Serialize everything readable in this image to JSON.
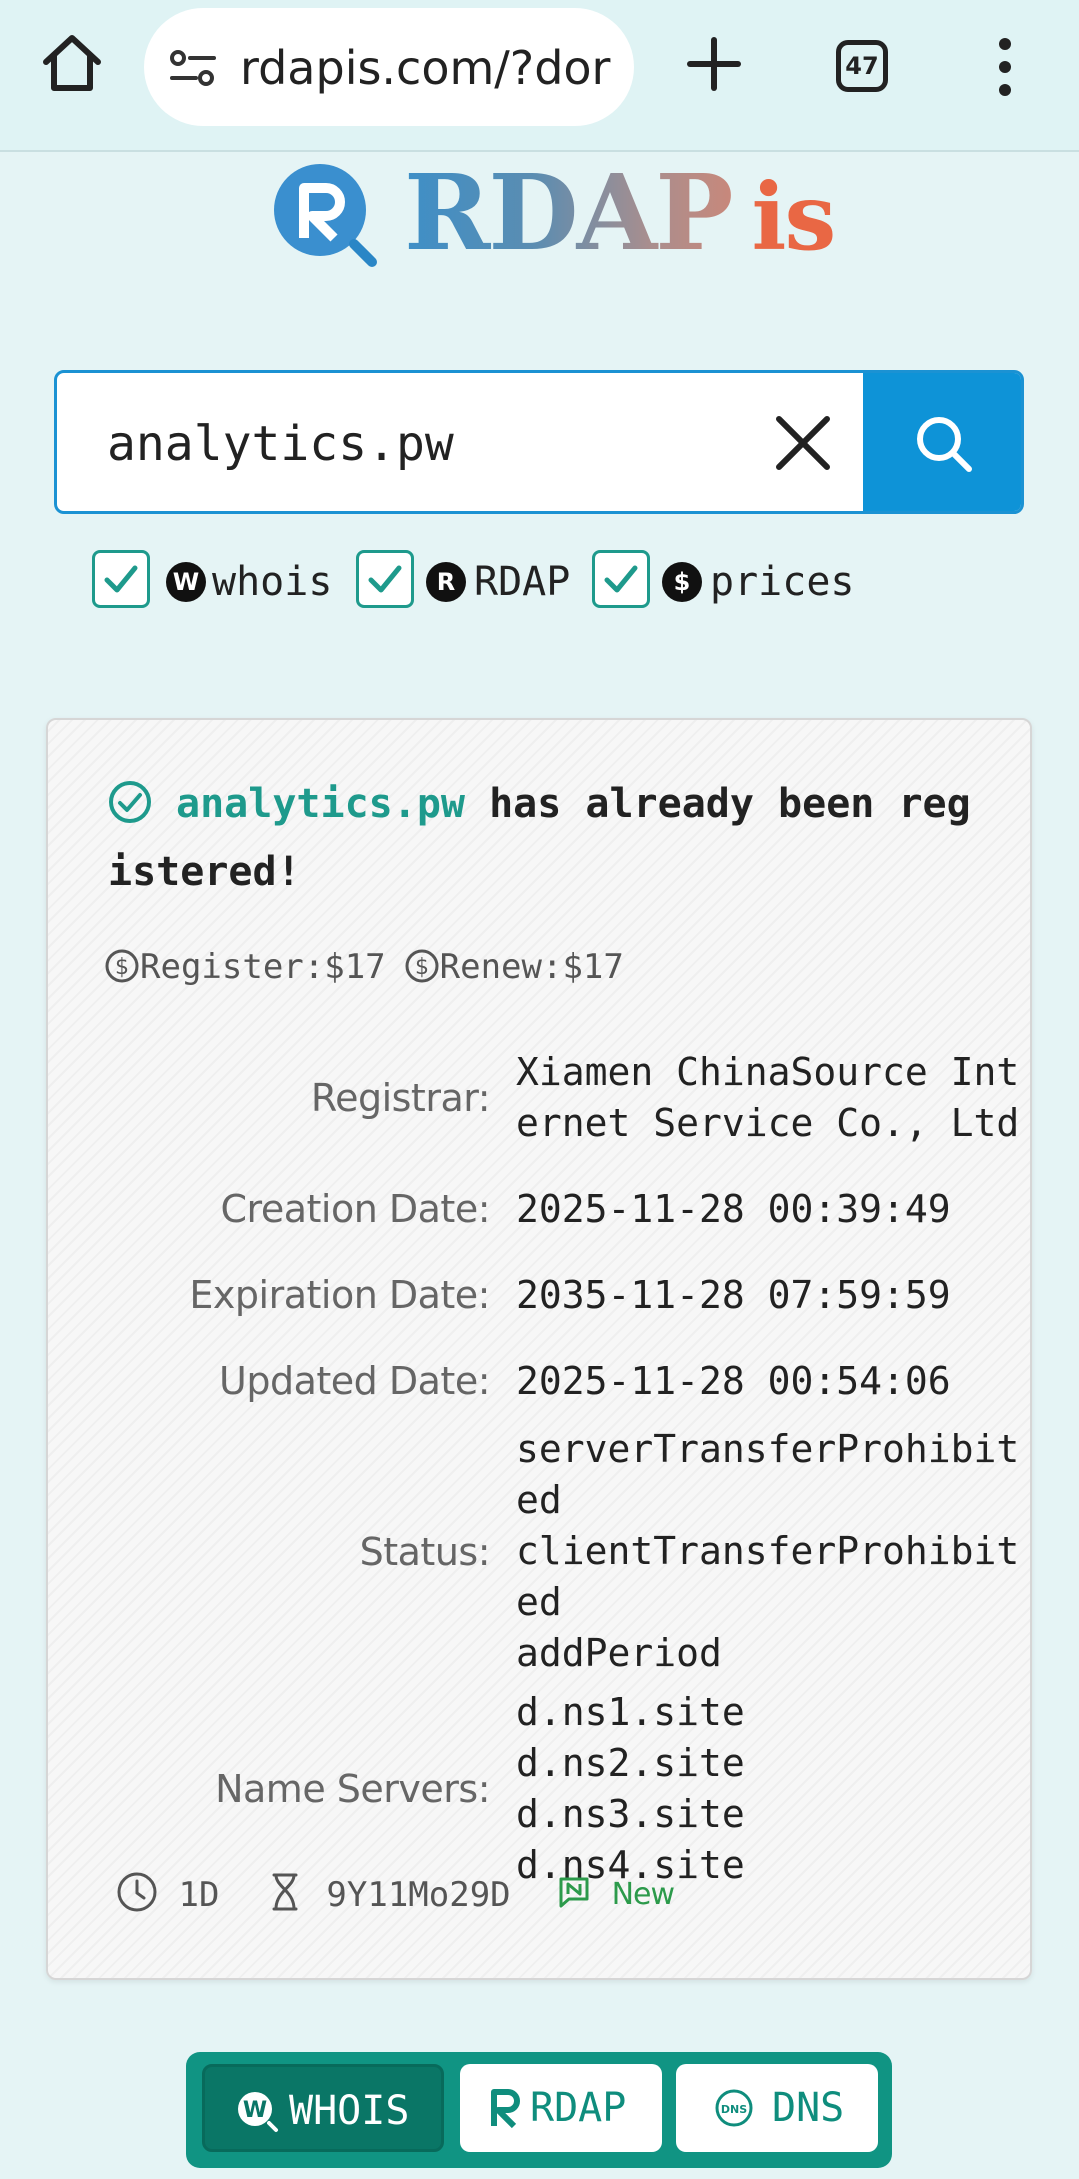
{
  "browser": {
    "url": "rdapis.com/?dor",
    "tab_count": "47",
    "icons": [
      "home-icon",
      "site-settings-icon",
      "plus-icon",
      "tab-switcher-icon",
      "more-vert-icon"
    ]
  },
  "logo": {
    "rdap": "RDAP",
    "is": "is"
  },
  "search": {
    "value": "analytics.pw"
  },
  "options": [
    {
      "label": "whois",
      "icon": "W",
      "checked": true
    },
    {
      "label": "RDAP",
      "icon": "R",
      "checked": true
    },
    {
      "label": "prices",
      "icon": "$",
      "checked": true
    }
  ],
  "result": {
    "domain": "analytics.pw",
    "message": " has already been registered!",
    "register_price": "Register:$17",
    "renew_price": "Renew:$17",
    "labels": {
      "registrar": "Registrar:",
      "creation": "Creation Date:",
      "expiration": "Expiration Date:",
      "updated": "Updated Date:",
      "status": "Status:",
      "nameservers": "Name Servers:"
    },
    "registrar": "Xiamen ChinaSource Internet Service Co., Ltd",
    "creation_date": "2025-11-28 00:39:49",
    "expiration_date": "2035-11-28 07:59:59",
    "updated_date": "2025-11-28 00:54:06",
    "status": [
      "serverTransferProhibited",
      "clientTransferProhibited",
      "addPeriod"
    ],
    "name_servers": [
      "d.ns1.site",
      "d.ns2.site",
      "d.ns3.site",
      "d.ns4.site"
    ],
    "age": "1D",
    "remaining": "9Y11Mo29D",
    "badge": "New"
  },
  "tabs": [
    {
      "label": "WHOIS",
      "active": true
    },
    {
      "label": "RDAP",
      "active": false
    },
    {
      "label": "DNS",
      "active": false
    }
  ],
  "colors": {
    "accent": "#1e9a8c",
    "search_button": "#0e93d7",
    "logo_is": "#e96744",
    "new_badge": "#2c9a4b"
  }
}
